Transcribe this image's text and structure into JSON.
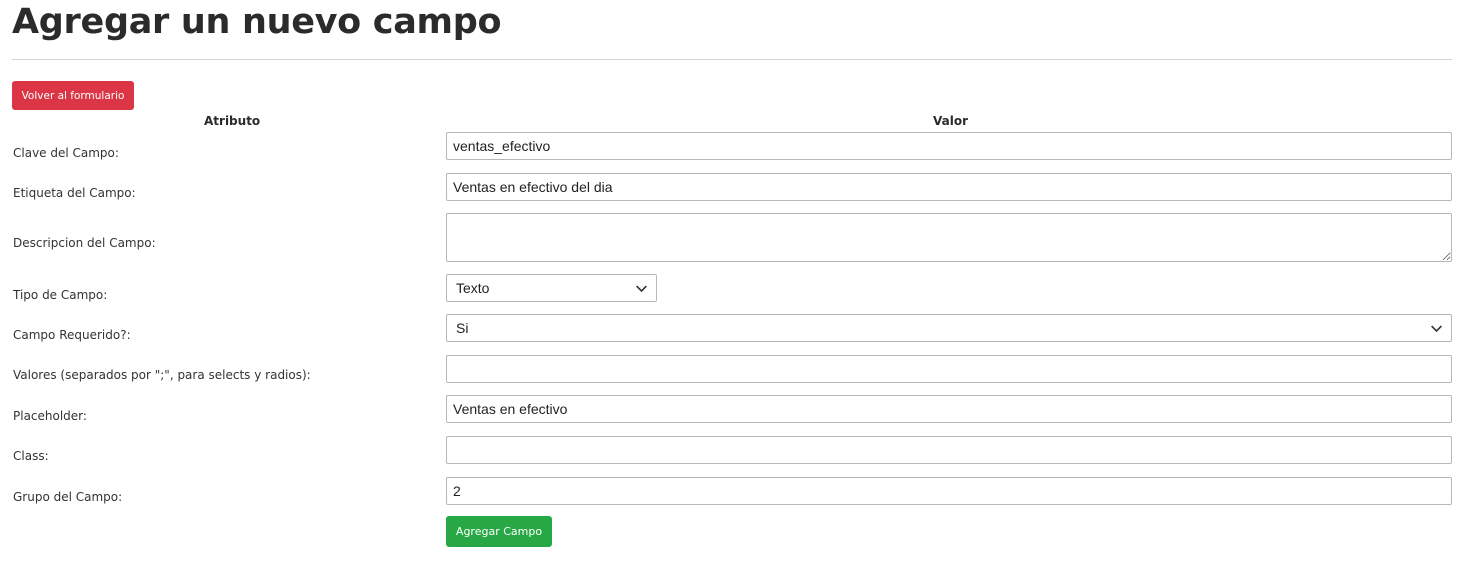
{
  "page": {
    "title": "Agregar un nuevo campo",
    "back_button_label": "Volver al formulario"
  },
  "table": {
    "col_attribute": "Atributo",
    "col_value": "Valor"
  },
  "fields": {
    "clave": {
      "label": "Clave del Campo:",
      "value": "ventas_efectivo"
    },
    "etiqueta": {
      "label": "Etiqueta del Campo:",
      "value": "Ventas en efectivo del dia"
    },
    "descripcion": {
      "label": "Descripcion del Campo:",
      "value": ""
    },
    "tipo": {
      "label": "Tipo de Campo:",
      "selected": "Texto"
    },
    "requerido": {
      "label": "Campo Requerido?:",
      "selected": "Si"
    },
    "valores": {
      "label": "Valores (separados por \";\", para selects y radios):",
      "value": ""
    },
    "placeholder": {
      "label": "Placeholder:",
      "value": "Ventas en efectivo"
    },
    "class": {
      "label": "Class:",
      "value": ""
    },
    "grupo": {
      "label": "Grupo del Campo:",
      "value": "2"
    }
  },
  "submit_button_label": "Agregar Campo",
  "colors": {
    "danger": "#dc3545",
    "success": "#28a745"
  },
  "icons": {
    "select_arrow": "chevron-down-icon",
    "textarea_resize": "resize-handle-icon"
  }
}
